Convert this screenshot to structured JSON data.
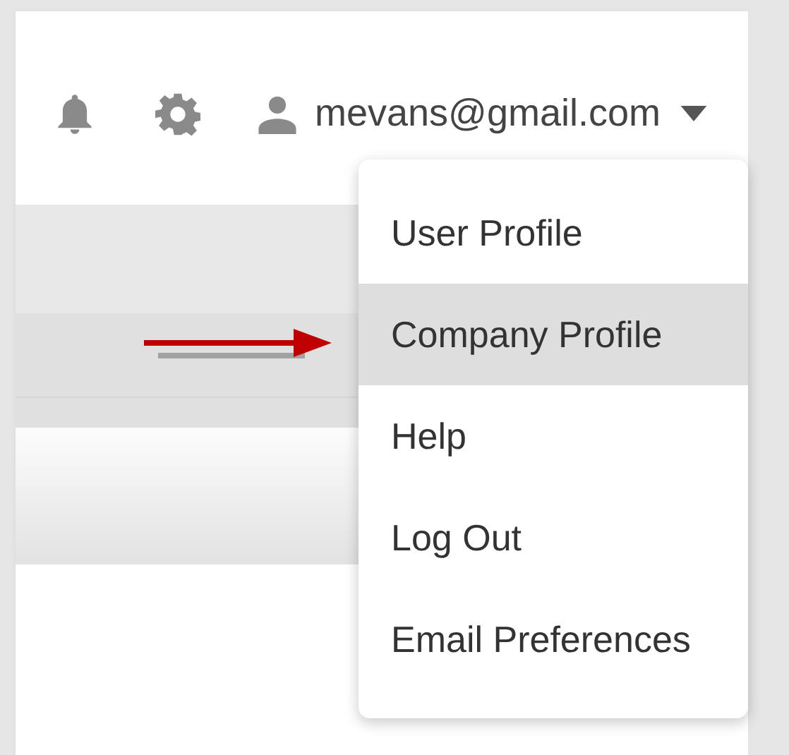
{
  "header": {
    "user_email": "mevans@gmail.com"
  },
  "user_menu": {
    "items": [
      {
        "label": "User Profile",
        "selected": false
      },
      {
        "label": "Company Profile",
        "selected": true
      },
      {
        "label": "Help",
        "selected": false
      },
      {
        "label": "Log Out",
        "selected": false
      },
      {
        "label": "Email Preferences",
        "selected": false
      }
    ]
  }
}
